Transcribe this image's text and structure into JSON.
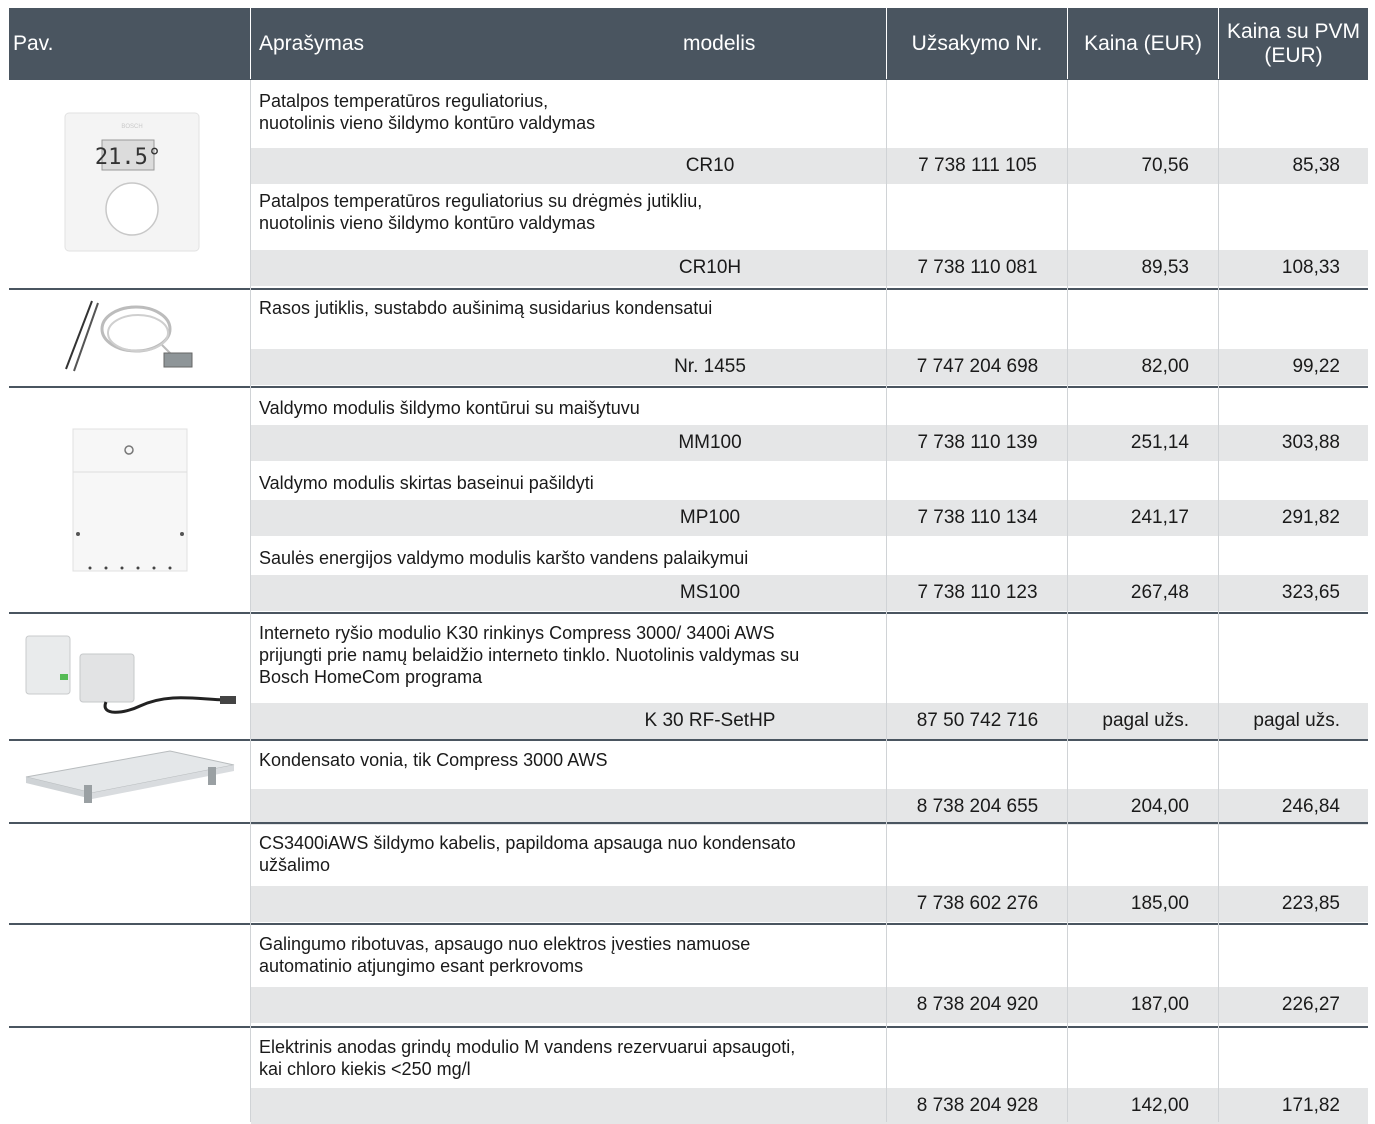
{
  "header": {
    "pav": "Pav.",
    "aprasymas": "Aprašymas",
    "modelis": "modelis",
    "uzsakymo_nr": "Užsakymo Nr.",
    "kaina": "Kaina (EUR)",
    "kaina_pvm": "Kaina su PVM (EUR)"
  },
  "rows": [
    {
      "description": "Patalpos temperatūros reguliatorius,\nnuotolinis vieno šildymo kontūro valdymas",
      "model": "CR10",
      "order": "7 738 111 105",
      "price": "70,56",
      "price_vat": "85,38"
    },
    {
      "description": "Patalpos temperatūros reguliatorius su drėgmės jutikliu,\nnuotolinis vieno šildymo kontūro valdymas",
      "model": "CR10H",
      "order": "7 738 110 081",
      "price": "89,53",
      "price_vat": "108,33"
    },
    {
      "description": "Rasos jutiklis, sustabdo aušinimą susidarius kondensatui",
      "model": "Nr. 1455",
      "order": "7 747 204 698",
      "price": "82,00",
      "price_vat": "99,22"
    },
    {
      "description": "Valdymo modulis šildymo kontūrui su maišytuvu",
      "model": "MM100",
      "order": "7 738 110 139",
      "price": "251,14",
      "price_vat": "303,88"
    },
    {
      "description": "Valdymo modulis skirtas baseinui pašildyti",
      "model": "MP100",
      "order": "7 738 110 134",
      "price": "241,17",
      "price_vat": "291,82"
    },
    {
      "description": "Saulės energijos valdymo modulis karšto vandens palaikymui",
      "model": "MS100",
      "order": "7 738 110 123",
      "price": "267,48",
      "price_vat": "323,65"
    },
    {
      "description": "Interneto ryšio modulio K30 rinkinys Compress 3000/ 3400i AWS\nprijungti prie namų belaidžio interneto tinklo. Nuotolinis valdymas su\nBosch HomeCom programa",
      "model": "K 30 RF-SetHP",
      "order": "87 50 742 716",
      "price": "pagal užs.",
      "price_vat": "pagal užs."
    },
    {
      "description": "Kondensato vonia, tik Compress 3000 AWS",
      "model": "",
      "order": "8 738 204 655",
      "price": "204,00",
      "price_vat": "246,84"
    },
    {
      "description": "CS3400iAWS šildymo kabelis, papildoma apsauga nuo kondensato\nužšalimo",
      "model": "",
      "order": "7 738 602 276",
      "price": "185,00",
      "price_vat": "223,85"
    },
    {
      "description": "Galingumo ribotuvas, apsaugo nuo elektros įvesties namuose\nautomatinio atjungimo esant perkrovoms",
      "model": "",
      "order": "8 738 204 920",
      "price": "187,00",
      "price_vat": "226,27"
    },
    {
      "description": "Elektrinis anodas grindų modulio M vandens rezervuarui apsaugoti,\nkai chloro kiekis <250 mg/l",
      "model": "",
      "order": "8 738 204 928",
      "price": "142,00",
      "price_vat": "171,82"
    }
  ],
  "thermostat_display": "21.5°",
  "thermostat_brand": "BOSCH"
}
